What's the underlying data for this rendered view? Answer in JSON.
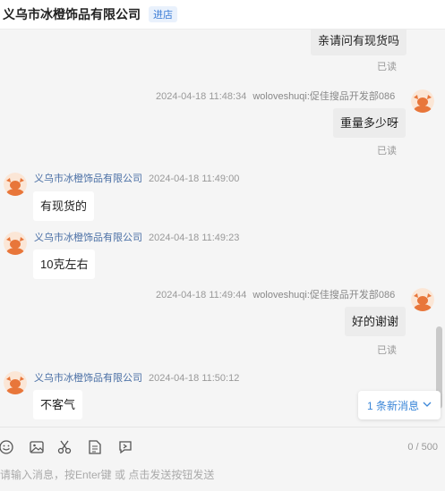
{
  "header": {
    "title": "义乌市冰橙饰品有限公司",
    "badge": "进店"
  },
  "messages": {
    "m1": {
      "text": "亲请问有现货吗",
      "read": "已读"
    },
    "m2": {
      "time": "2024-04-18 11:48:34",
      "sender": "woloveshuqi:促佳搜品开发部086",
      "text": "重量多少呀",
      "read": "已读"
    },
    "m3": {
      "shop": "义乌市冰橙饰品有限公司",
      "time": "2024-04-18 11:49:00",
      "text": "有现货的"
    },
    "m4": {
      "shop": "义乌市冰橙饰品有限公司",
      "time": "2024-04-18 11:49:23",
      "text": "10克左右"
    },
    "m5": {
      "time": "2024-04-18 11:49:44",
      "sender": "woloveshuqi:促佳搜品开发部086",
      "text": "好的谢谢",
      "read": "已读"
    },
    "m6": {
      "shop": "义乌市冰橙饰品有限公司",
      "time": "2024-04-18 11:50:12",
      "text": "不客气"
    }
  },
  "new_messages": {
    "label": "1 条新消息",
    "icon": "chevron-down-icon"
  },
  "composer": {
    "counter": "0 / 500",
    "placeholder": "请输入消息，按Enter键 或 点击发送按钮发送",
    "tools": [
      "emoji-icon",
      "image-icon",
      "scissors-icon",
      "document-icon",
      "quick-reply-icon"
    ]
  },
  "colors": {
    "accent": "#3a86d8",
    "avatar": "#e8763a",
    "bubble_mine": "#ececec"
  }
}
